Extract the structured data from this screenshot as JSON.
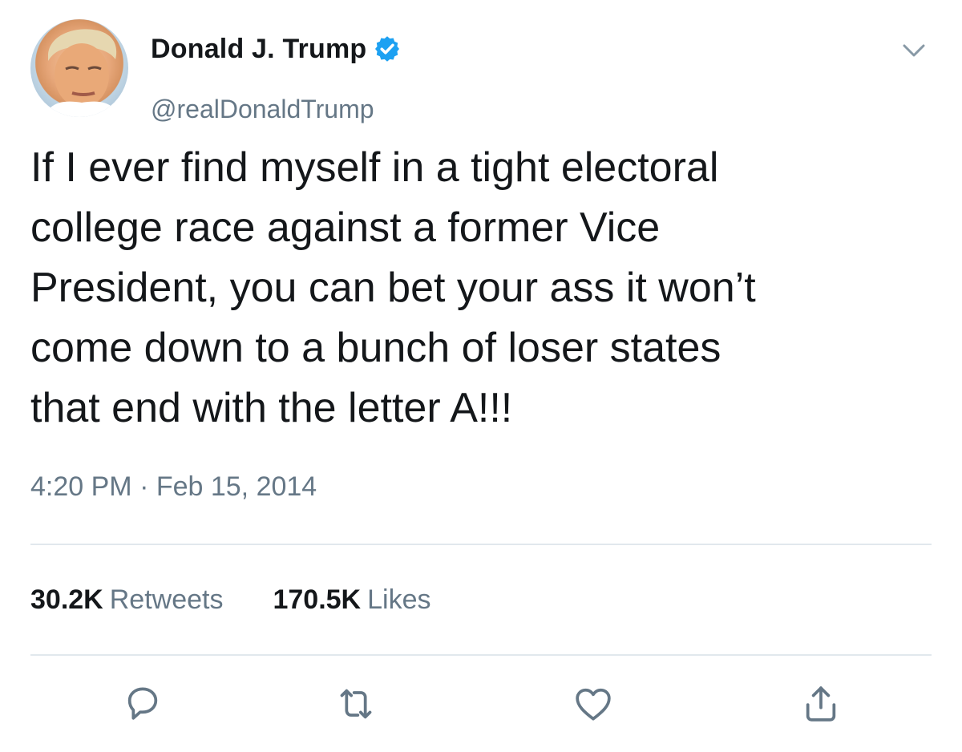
{
  "author": {
    "display_name": "Donald J. Trump",
    "handle": "@realDonaldTrump",
    "verified": true
  },
  "tweet": {
    "text_lines": [
      "If I ever find myself in a tight electoral",
      "college race against a former Vice",
      "President, you can bet your ass it won’t",
      "come down to a bunch of loser states",
      "that end with the letter A!!!"
    ],
    "timestamp": "4:20 PM · Feb 15, 2014"
  },
  "stats": {
    "retweets_value": "30.2K",
    "retweets_label": "Retweets",
    "likes_value": "170.5K",
    "likes_label": "Likes"
  },
  "icons": {
    "verified": "verified-badge-icon",
    "caret": "chevron-down-icon",
    "reply": "reply-icon",
    "retweet": "retweet-icon",
    "like": "heart-icon",
    "share": "share-icon"
  },
  "colors": {
    "text": "#14171a",
    "secondary": "#657786",
    "verified_blue": "#1da1f2",
    "divider": "#e1e8ed"
  }
}
